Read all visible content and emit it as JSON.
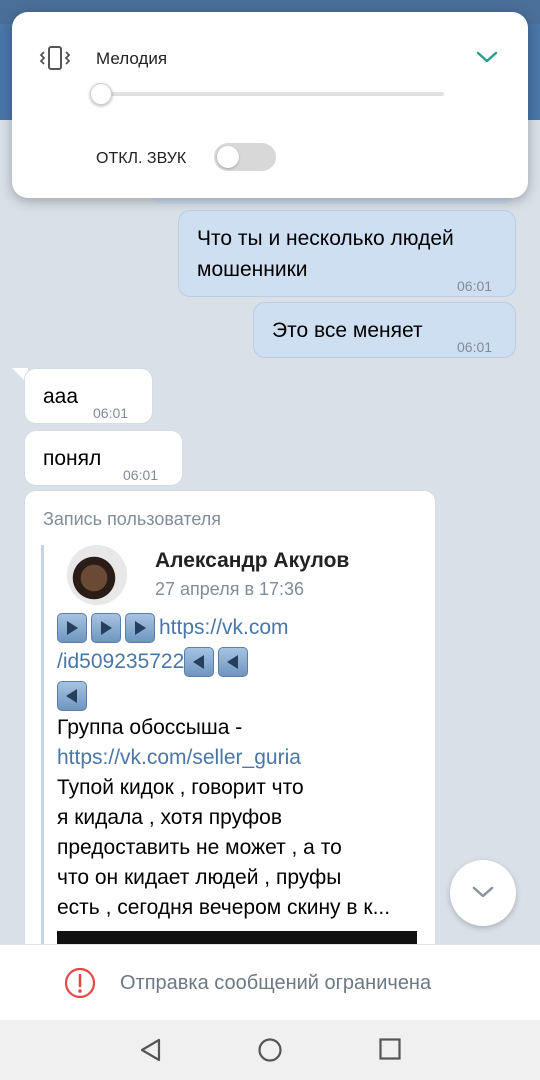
{
  "volume_panel": {
    "label": "Мелодия",
    "level": 0,
    "mute_label": "ОТКЛ. ЗВУК",
    "mute_on": false
  },
  "messages": [
    {
      "direction": "out",
      "lines": [
        "Что ты и несколько людей",
        "мошенники"
      ],
      "time": "06:01"
    },
    {
      "direction": "out",
      "text": "Это все меняет",
      "time": "06:01"
    },
    {
      "direction": "in",
      "text": "ааа",
      "time": "06:01"
    },
    {
      "direction": "in",
      "text": "понял",
      "time": "06:01"
    }
  ],
  "shared_post": {
    "header": "Запись пользователя",
    "author": "Александр Акулов",
    "date": "27 апреля в 17:36",
    "link1_a": "https://vk.com",
    "link1_b": "/id509235722",
    "group_text": "Группа обоссыша -",
    "link2": "https://vk.com/seller_guria",
    "body_lines": [
      "Тупой кидок , говорит что",
      "я кидала , хотя пруфов",
      "предоставить не может , а то",
      "что он кидает людей , пруфы",
      "есть , сегодня вечером скину в к..."
    ]
  },
  "restricted_notice": "Отправка сообщений ограничена",
  "colors": {
    "accent": "#4a76a8",
    "outgoing_bubble": "#cfdff2",
    "warning": "#e64646",
    "toggle_accent": "#2a9d8f"
  }
}
